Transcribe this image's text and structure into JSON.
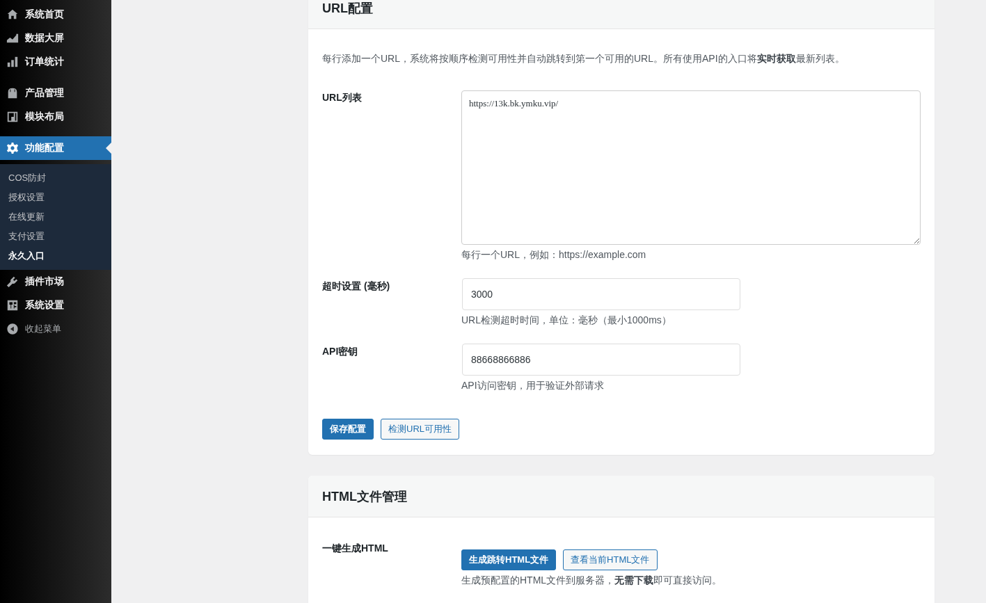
{
  "sidebar": {
    "groups": [
      {
        "items": [
          {
            "label": "系统首页",
            "kind": "link",
            "selected": false
          },
          {
            "label": "数据大屏",
            "kind": "link",
            "selected": false
          },
          {
            "label": "订单统计",
            "kind": "link",
            "selected": false
          }
        ]
      },
      {
        "items": [
          {
            "label": "产品管理",
            "kind": "link",
            "selected": false
          },
          {
            "label": "模块布局",
            "kind": "link",
            "selected": false
          }
        ]
      },
      {
        "items": [
          {
            "label": "功能配置",
            "kind": "link",
            "selected": true,
            "children": [
              {
                "label": "COS防封",
                "selected": false
              },
              {
                "label": "授权设置",
                "selected": false
              },
              {
                "label": "在线更新",
                "selected": false
              },
              {
                "label": "支付设置",
                "selected": false
              },
              {
                "label": "永久入口",
                "selected": true
              }
            ]
          },
          {
            "label": "插件市场",
            "kind": "link",
            "selected": false
          },
          {
            "label": "系统设置",
            "kind": "link",
            "selected": false
          },
          {
            "label": "收起菜单",
            "kind": "collapse",
            "selected": false
          }
        ]
      }
    ]
  },
  "cards": [
    {
      "title": "URL配置",
      "description": "每行添加一个URL，系统将按顺序检测可用性并自动跳转到第一个可用的URL。所有使用API的入口将**实时获取**最新列表。",
      "rows": [
        {
          "label": "URL列表",
          "kind": "textarea",
          "value": "https://13k.bk.ymku.vip/",
          "help": "每行一个URL，例如：https://example.com"
        },
        {
          "label": "超时设置 (毫秒)",
          "kind": "input",
          "value": "3000",
          "help": "URL检测超时时间，单位：毫秒（最小1000ms）"
        },
        {
          "label": "API密钥",
          "kind": "input",
          "value": "88668866886",
          "help": "API访问密钥，用于验证外部请求"
        }
      ],
      "buttons": [
        {
          "label": "保存配置",
          "kind": "primary"
        },
        {
          "label": "检测URL可用性",
          "kind": "secondary"
        }
      ]
    },
    {
      "title": "HTML文件管理",
      "rows": [
        {
          "label": "一键生成HTML",
          "kind": "buttons",
          "buttons": [
            {
              "label": "生成跳转HTML文件",
              "kind": "primary"
            },
            {
              "label": "查看当前HTML文件",
              "kind": "secondary"
            }
          ],
          "help": "生成预配置的HTML文件到服务器，**无需下载**即可直接访问。"
        }
      ]
    }
  ]
}
